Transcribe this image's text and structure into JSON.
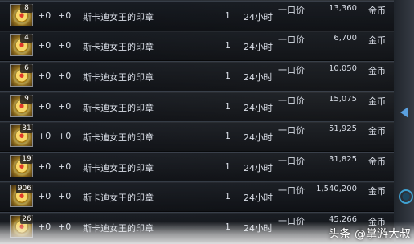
{
  "rows": [
    {
      "count": "8",
      "bonus1": "+0",
      "bonus2": "+0",
      "name": "斯卡迪女王的印章",
      "qty": "1",
      "time": "24小时",
      "type": "一口价",
      "price": "13,360",
      "currency": "金币"
    },
    {
      "count": "4",
      "bonus1": "+0",
      "bonus2": "+0",
      "name": "斯卡迪女王的印章",
      "qty": "1",
      "time": "24小时",
      "type": "一口价",
      "price": "6,700",
      "currency": "金币"
    },
    {
      "count": "6",
      "bonus1": "+0",
      "bonus2": "+0",
      "name": "斯卡迪女王的印章",
      "qty": "1",
      "time": "24小时",
      "type": "一口价",
      "price": "10,050",
      "currency": "金币"
    },
    {
      "count": "9",
      "bonus1": "+0",
      "bonus2": "+0",
      "name": "斯卡迪女王的印章",
      "qty": "1",
      "time": "24小时",
      "type": "一口价",
      "price": "15,075",
      "currency": "金币"
    },
    {
      "count": "31",
      "bonus1": "+0",
      "bonus2": "+0",
      "name": "斯卡迪女王的印章",
      "qty": "1",
      "time": "24小时",
      "type": "一口价",
      "price": "51,925",
      "currency": "金币"
    },
    {
      "count": "19",
      "bonus1": "+0",
      "bonus2": "+0",
      "name": "斯卡迪女王的印章",
      "qty": "1",
      "time": "24小时",
      "type": "一口价",
      "price": "31,825",
      "currency": "金币"
    },
    {
      "count": "906",
      "bonus1": "+0",
      "bonus2": "+0",
      "name": "斯卡迪女王的印章",
      "qty": "1",
      "time": "24小时",
      "type": "一口价",
      "price": "1,540,200",
      "currency": "金币"
    },
    {
      "count": "26",
      "bonus1": "+0",
      "bonus2": "+0",
      "name": "斯卡迪女王的印章",
      "qty": "1",
      "time": "24小时",
      "type": "一口价",
      "price": "45,266",
      "currency": "金币"
    }
  ],
  "watermark": "头条 @掌游大叔"
}
